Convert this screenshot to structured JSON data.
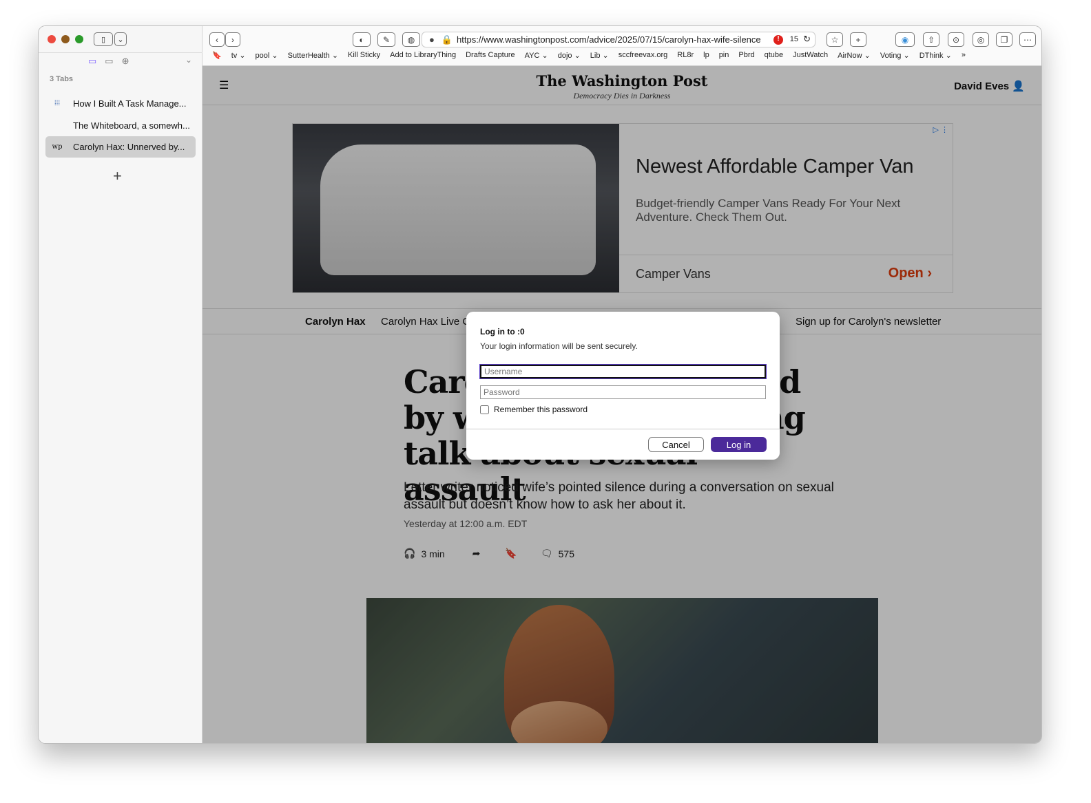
{
  "sidebar": {
    "tab_count": "3 Tabs",
    "tabs": [
      {
        "label": "How I Built A Task Manage...",
        "favicon": "grid-dots"
      },
      {
        "label": "The Whiteboard, a somewh...",
        "favicon": "blank"
      },
      {
        "label": "Carolyn Hax: Unnerved by...",
        "favicon": "wp",
        "active": true
      }
    ],
    "new_tab": "+"
  },
  "toolbar": {
    "url": "https://www.washingtonpost.com/advice/2025/07/15/carolyn-hax-wife-silence",
    "badge_count": "15",
    "bookmarks": [
      "tv ⌄",
      "pool ⌄",
      "SutterHealth ⌄",
      "Kill Sticky",
      "Add to LibraryThing",
      "Drafts Capture",
      "AYC ⌄",
      "dojo ⌄",
      "Lib ⌄",
      "sccfreevax.org",
      "RL8r",
      "lp",
      "pin",
      "Pbrd",
      "qtube",
      "JustWatch",
      "AirNow ⌄",
      "Voting ⌄",
      "DThink ⌄"
    ]
  },
  "page": {
    "logo": "The Washington Post",
    "tagline": "Democracy Dies in Darkness",
    "user": "David Eves",
    "ad": {
      "title": "Newest Affordable Camper Van",
      "desc": "Budget-friendly Camper Vans Ready For Your Next Adventure. Check Them Out.",
      "brand": "Camper Vans",
      "cta": "Open"
    },
    "nav": [
      "Carolyn Hax",
      "Carolyn Hax Live C",
      "Sign up for Carolyn's newsletter"
    ],
    "headline": "Carolyn Hax: Unnerved by wife's silence during talk about sexual assault",
    "dek": "Letter writer noticed wife’s pointed silence during a conversation on sexual assault but doesn’t know how to ask her about it.",
    "date": "Yesterday at 12:00 a.m. EDT",
    "listen": "3 min",
    "comments": "575"
  },
  "dialog": {
    "title": "Log in to :0",
    "subtitle": "Your login information will be sent securely.",
    "username_placeholder": "Username",
    "password_placeholder": "Password",
    "remember": "Remember this password",
    "cancel": "Cancel",
    "login": "Log in"
  },
  "colors": {
    "accent": "#4b2a9a",
    "ad_cta": "#e03d0e"
  }
}
